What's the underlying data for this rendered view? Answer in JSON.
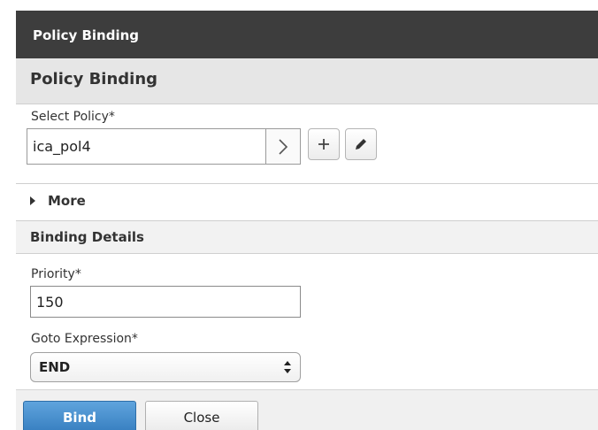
{
  "dialog": {
    "title": "Policy Binding"
  },
  "section": {
    "title": "Policy Binding"
  },
  "select_policy": {
    "label": "Select Policy*",
    "value": "ica_pol4",
    "icons": [
      "chevron-right-icon",
      "plus-icon",
      "pencil-icon"
    ]
  },
  "more": {
    "label": "More"
  },
  "binding_details": {
    "title": "Binding Details",
    "priority_label": "Priority*",
    "priority_value": "150",
    "goto_label": "Goto Expression*",
    "goto_value": "END"
  },
  "footer": {
    "bind_label": "Bind",
    "close_label": "Close"
  },
  "colors": {
    "titlebar": "#3d3d3d",
    "section_header": "#e6e6e6",
    "primary_button": "#3a81c2"
  }
}
